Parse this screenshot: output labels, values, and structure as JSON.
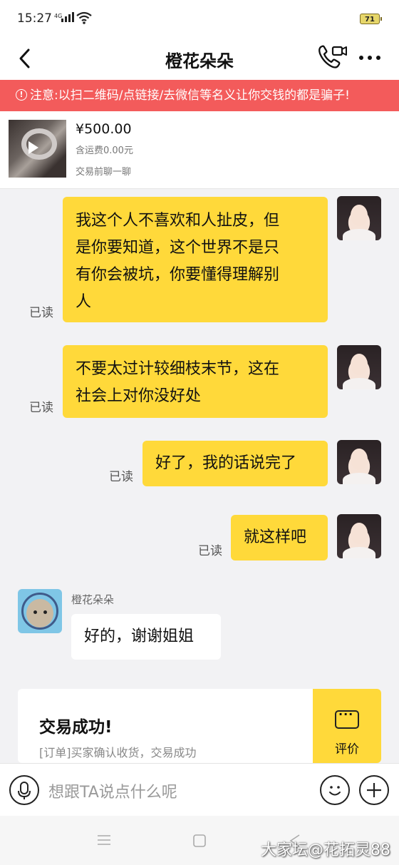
{
  "status": {
    "time": "15:27",
    "network": "4G",
    "battery": "71"
  },
  "header": {
    "title": "橙花朵朵",
    "back_icon": "chevron-left-icon",
    "call_icon": "video-call-icon",
    "more_icon": "more-dots-icon"
  },
  "warning": {
    "text": "注意:以扫二维码/点链接/去微信等名义让你交钱的都是骗子!"
  },
  "product": {
    "price": "¥500.00",
    "shipping": "含运费0.00元",
    "chat_link": "交易前聊一聊"
  },
  "messages": [
    {
      "side": "right",
      "status": "已读",
      "lines": [
        "我这个人不喜欢和人扯皮，但",
        "是你要知道，这个世界不是只",
        "有你会被坑，你要懂得理解别",
        "人"
      ]
    },
    {
      "side": "right",
      "status": "已读",
      "lines": [
        "不要太过计较细枝末节，这在",
        "社会上对你没好处"
      ]
    },
    {
      "side": "right",
      "status": "已读",
      "lines": [
        "好了，我的话说完了"
      ]
    },
    {
      "side": "right",
      "status": "已读",
      "lines": [
        "就这样吧"
      ]
    },
    {
      "side": "left",
      "sender": "橙花朵朵",
      "lines": [
        "好的，谢谢姐姐"
      ]
    }
  ],
  "order_card": {
    "title": "交易成功!",
    "subtitle": "[订单]买家确认收货，交易成功",
    "rate_label": "评价"
  },
  "input": {
    "placeholder": "想跟TA说点什么呢"
  },
  "watermark": "大家坛@花拓灵88"
}
